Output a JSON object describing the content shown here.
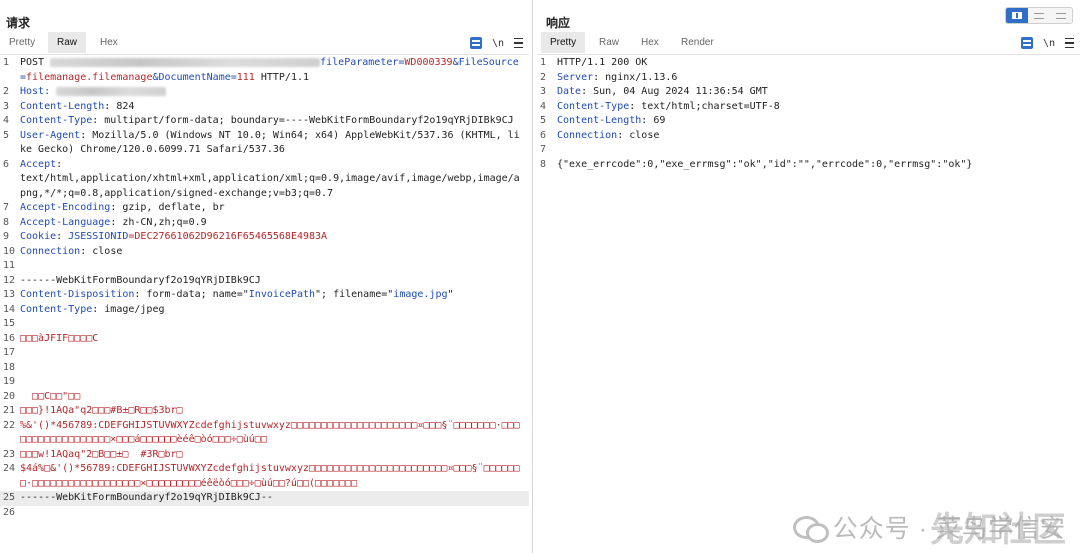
{
  "request": {
    "title": "请求",
    "tabs": [
      "Pretty",
      "Raw",
      "Hex"
    ],
    "active_tab": "Raw",
    "newline_label": "\\n",
    "lines": {
      "l1a": "POST ",
      "l1b": "fileParameter=",
      "l1c": "WD000339",
      "l1d": "&FileSource=",
      "l1e": "filemanage.filemanage",
      "l1f": "&DocumentName=",
      "l1g": "111",
      "l1h": " HTTP/1.1",
      "l2k": "Host: ",
      "l3k": "Content-Length",
      "l3v": ": 824",
      "l4k": "Content-Type",
      "l4v": ": multipart/form-data; boundary=----WebKitFormBoundaryf2o19qYRjDIBk9CJ",
      "l5k": "User-Agent",
      "l5v": ": Mozilla/5.0 (Windows NT 10.0; Win64; x64) AppleWebKit/537.36 (KHTML, like Gecko) Chrome/120.0.6099.71 Safari/537.36",
      "l6k": "Accept",
      "l6v": ":",
      "l6c": "text/html,application/xhtml+xml,application/xml;q=0.9,image/avif,image/webp,image/apng,*/*;q=0.8,application/signed-exchange;v=b3;q=0.7",
      "l7k": "Accept-Encoding",
      "l7v": ": gzip, deflate, br",
      "l8k": "Accept-Language",
      "l8v": ": zh-CN,zh;q=0.9",
      "l9k": "Cookie",
      "l9v": ": ",
      "l9c": "JSESSIONID",
      "l9d": "=DEC27661062D96216F65465568E4983A",
      "l10k": "Connection",
      "l10v": ": close",
      "l12": "------WebKitFormBoundaryf2o19qYRjDIBk9CJ",
      "l13k": "Content-Disposition",
      "l13v": ": form-data; name=\"",
      "l13n": "InvoicePath",
      "l13m": "\"; filename=\"",
      "l13f": "image.jpg",
      "l13e": "\"",
      "l14k": "Content-Type",
      "l14v": ": image/jpeg",
      "l16": "□□□àJFIF□□□□C",
      "l20": "  □□C□□\"□□",
      "l21": "□□□}!1AQa\"q2□□□#B±□R□□$3br□",
      "l22": "%&'()*456789:CDEFGHIJSTUVWXYZcdefghijstuvwxyz□□□□□□□□□□□□□□□□□□□□□¤□□□§¨□□□□□□□·□□□□□□□□□□□□□□□□□□×□□□á□□□□□□èéê□òó□□□÷□ùú□□",
      "l23": "□□□w!1AQaq\"2□B□□±□  #3R□br□",
      "l24": "$4á%□&'()*56789:CDEFGHIJSTUVWXYZcdefghijstuvwxyz□□□□□□□□□□□□□□□□□□□□□□□¤□□□§¨□□□□□□□·□□□□□□□□□□□□□□□□□□×□□□□□□□□□éêëòó□□□÷□ùú□□?ú□□(□□□□□□□",
      "l25": "------WebKitFormBoundaryf2o19qYRjDIBk9CJ--"
    }
  },
  "response": {
    "title": "响应",
    "tabs": [
      "Pretty",
      "Raw",
      "Hex",
      "Render"
    ],
    "active_tab": "Pretty",
    "newline_label": "\\n",
    "lines": {
      "l1": "HTTP/1.1 200 OK",
      "l2k": "Server",
      "l2v": ": nginx/1.13.6",
      "l3k": "Date",
      "l3v": ": Sun, 04 Aug 2024 11:36:54 GMT",
      "l4k": "Content-Type",
      "l4v": ": text/html;charset=UTF-8",
      "l5k": "Content-Length",
      "l5v": ": 69",
      "l6k": "Connection",
      "l6v": ": close",
      "l8": "{\"exe_errcode\":0,\"exe_errmsg\":\"ok\",\"id\":\"\",\"errcode\":0,\"errmsg\":\"ok\"}"
    }
  },
  "watermark": {
    "text": "公众号 · 菜鸟学信安",
    "sub": "先知社区"
  },
  "colors": {
    "header_key": "#1f4bb8",
    "value_red": "#b5262a",
    "accent": "#2f6fc8"
  }
}
